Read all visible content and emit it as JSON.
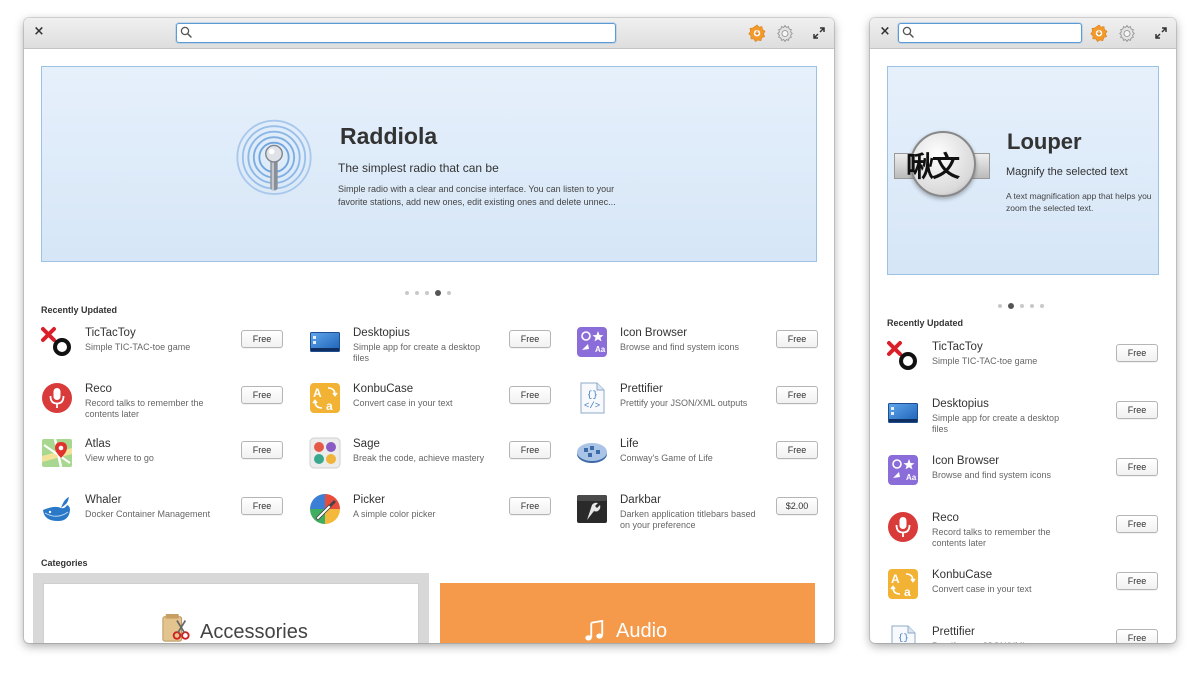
{
  "main": {
    "close_label": "×",
    "search": {
      "value": "",
      "placeholder": ""
    },
    "banner": {
      "title": "Raddiola",
      "subtitle": "The simplest radio that can be",
      "description": "Simple radio with a clear and concise interface. You can listen to your favorite stations, add new ones, edit existing ones and delete unnec..."
    },
    "pager": {
      "count": 5,
      "active": 4
    },
    "recently_updated_title": "Recently Updated",
    "apps": [
      {
        "name": "TicTacToy",
        "desc": "Simple TIC-TAC-toe game",
        "price": "Free",
        "icon": "tictactoy-icon"
      },
      {
        "name": "Desktopius",
        "desc": "Simple app for create a desktop files",
        "price": "Free",
        "icon": "desktopius-icon"
      },
      {
        "name": "Icon Browser",
        "desc": "Browse and find system icons",
        "price": "Free",
        "icon": "icon-browser-icon"
      },
      {
        "name": "Reco",
        "desc": "Record talks to remember the contents later",
        "price": "Free",
        "icon": "reco-microphone-icon"
      },
      {
        "name": "KonbuCase",
        "desc": "Convert case in your text",
        "price": "Free",
        "icon": "konbucase-icon"
      },
      {
        "name": "Prettifier",
        "desc": "Prettify your JSON/XML outputs",
        "price": "Free",
        "icon": "prettifier-icon"
      },
      {
        "name": "Atlas",
        "desc": "View where to go",
        "price": "Free",
        "icon": "atlas-map-icon"
      },
      {
        "name": "Sage",
        "desc": "Break the code, achieve mastery",
        "price": "Free",
        "icon": "sage-icon"
      },
      {
        "name": "Life",
        "desc": "Conway's Game of Life",
        "price": "Free",
        "icon": "life-icon"
      },
      {
        "name": "Whaler",
        "desc": "Docker Container Management",
        "price": "Free",
        "icon": "whaler-whale-icon"
      },
      {
        "name": "Picker",
        "desc": "A simple color picker",
        "price": "Free",
        "icon": "picker-icon"
      },
      {
        "name": "Darkbar",
        "desc": "Darken application titlebars based on your preference",
        "price": "$2.00",
        "icon": "darkbar-icon"
      }
    ],
    "categories_title": "Categories",
    "categories": [
      {
        "label": "Accessories",
        "icon": "accessories-scissors-icon",
        "color": "#ffffff"
      },
      {
        "label": "Audio",
        "icon": "music-note-icon",
        "color": "#f49a4a"
      }
    ]
  },
  "small": {
    "close_label": "×",
    "search": {
      "value": "",
      "placeholder": ""
    },
    "banner": {
      "title": "Louper",
      "subtitle": "Magnify the selected text",
      "description": "A text magnification app that helps you zoom the selected text.",
      "icon_text": "啾文"
    },
    "pager": {
      "count": 5,
      "active": 2
    },
    "recently_updated_title": "Recently Updated",
    "apps": [
      {
        "name": "TicTacToy",
        "desc": "Simple TIC-TAC-toe game",
        "price": "Free",
        "icon": "tictactoy-icon"
      },
      {
        "name": "Desktopius",
        "desc": "Simple app for create a desktop files",
        "price": "Free",
        "icon": "desktopius-icon"
      },
      {
        "name": "Icon Browser",
        "desc": "Browse and find system icons",
        "price": "Free",
        "icon": "icon-browser-icon"
      },
      {
        "name": "Reco",
        "desc": "Record talks to remember the contents later",
        "price": "Free",
        "icon": "reco-microphone-icon"
      },
      {
        "name": "KonbuCase",
        "desc": "Convert case in your text",
        "price": "Free",
        "icon": "konbucase-icon"
      },
      {
        "name": "Prettifier",
        "desc": "Prettify your JSON/XML outputs",
        "price": "Free",
        "icon": "prettifier-icon"
      }
    ]
  },
  "colors": {
    "accent": "#5b9bd5",
    "banner_bg": "#dbe9f8",
    "banner_border": "#9cc2e6",
    "update_orange": "#f5a623",
    "audio_orange": "#f49a4a"
  }
}
